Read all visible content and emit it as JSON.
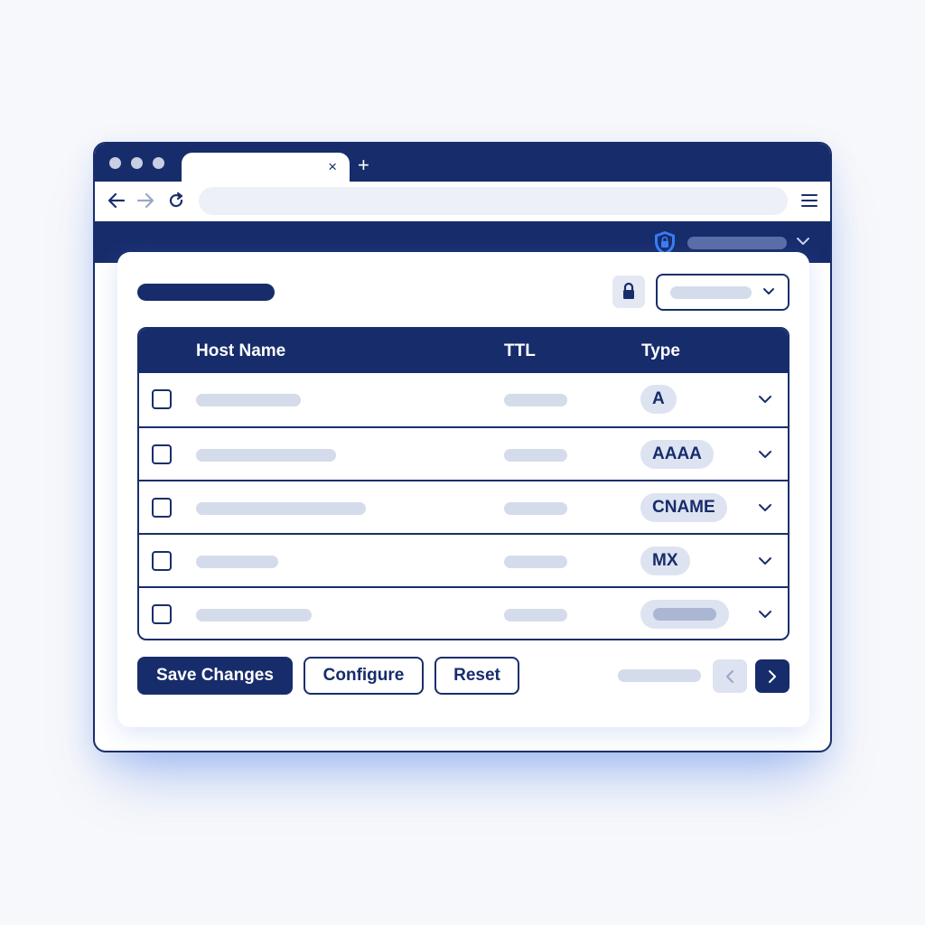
{
  "browser": {
    "tab_close": "×",
    "new_tab": "+"
  },
  "table": {
    "columns": [
      "Host Name",
      "TTL",
      "Type"
    ],
    "rows": [
      {
        "type": "A"
      },
      {
        "type": "AAAA"
      },
      {
        "type": "CNAME"
      },
      {
        "type": "MX"
      },
      {
        "type": ""
      }
    ]
  },
  "actions": {
    "save": "Save Changes",
    "configure": "Configure",
    "reset": "Reset"
  },
  "colors": {
    "primary": "#172c6b",
    "placeholder": "#d4dbeb",
    "badge_bg": "#dde3f0",
    "shield": "#3b7cf5",
    "shadow": "#4678e6"
  },
  "icons": [
    "back-arrow-icon",
    "forward-arrow-icon",
    "reload-icon",
    "menu-icon",
    "shield-lock-icon",
    "chevron-down-icon",
    "lock-icon",
    "chevron-left-icon",
    "chevron-right-icon"
  ]
}
